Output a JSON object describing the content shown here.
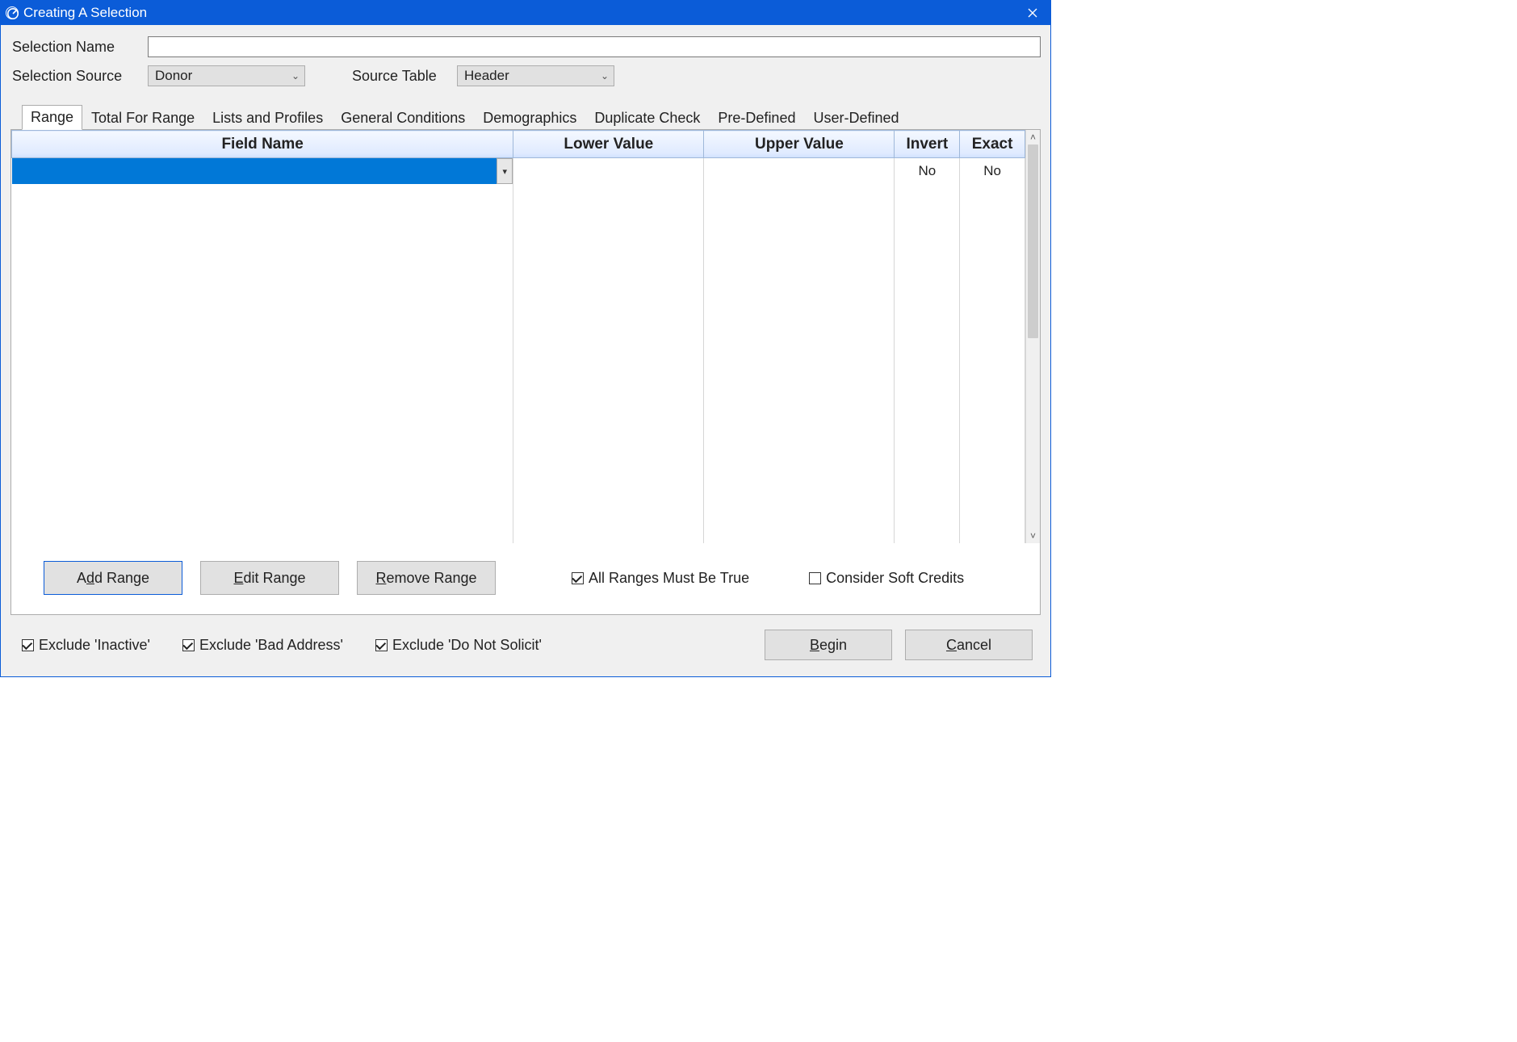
{
  "window": {
    "title": "Creating A Selection"
  },
  "form": {
    "selection_name_label": "Selection Name",
    "selection_name_value": "",
    "selection_source_label": "Selection Source",
    "selection_source_value": "Donor",
    "source_table_label": "Source Table",
    "source_table_value": "Header"
  },
  "tabs": [
    {
      "label": "Range"
    },
    {
      "label": "Total For Range"
    },
    {
      "label": "Lists and Profiles"
    },
    {
      "label": "General Conditions"
    },
    {
      "label": "Demographics"
    },
    {
      "label": "Duplicate Check"
    },
    {
      "label": "Pre-Defined"
    },
    {
      "label": "User-Defined"
    }
  ],
  "grid": {
    "columns": {
      "field": "Field Name",
      "lower": "Lower Value",
      "upper": "Upper Value",
      "invert": "Invert",
      "exact": "Exact"
    },
    "rows": [
      {
        "field": "",
        "lower": "",
        "upper": "",
        "invert": "No",
        "exact": "No"
      }
    ]
  },
  "range_buttons": {
    "add_pre": "A",
    "add_ul": "d",
    "add_post": "d Range",
    "edit_pre": "",
    "edit_ul": "E",
    "edit_post": "dit Range",
    "remove_pre": "",
    "remove_ul": "R",
    "remove_post": "emove Range"
  },
  "range_checks": {
    "all_true": "All Ranges Must Be True",
    "soft_credits": "Consider Soft Credits"
  },
  "bottom_checks": {
    "exclude_inactive": "Exclude 'Inactive'",
    "exclude_bad_address": "Exclude 'Bad Address'",
    "exclude_do_not_solicit": "Exclude 'Do Not Solicit'"
  },
  "bottom_buttons": {
    "begin_pre": "",
    "begin_ul": "B",
    "begin_post": "egin",
    "cancel_pre": "",
    "cancel_ul": "C",
    "cancel_post": "ancel"
  }
}
